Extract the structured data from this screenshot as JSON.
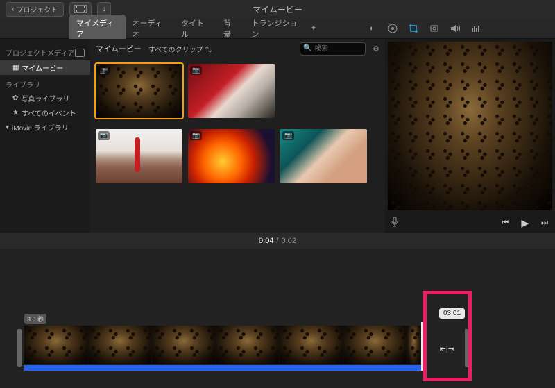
{
  "titlebar": {
    "back_label": "プロジェクト",
    "window_title": "マイムービー"
  },
  "tabs": {
    "mymedia": "マイメディア",
    "audio": "オーディオ",
    "title": "タイトル",
    "background": "背景",
    "transition": "トランジション"
  },
  "sidebar": {
    "project_media_head": "プロジェクトメディア",
    "project_item": "マイムービー",
    "library_head": "ライブラリ",
    "photo_library": "写真ライブラリ",
    "all_events": "すべてのイベント",
    "imovie_library": "iMovie ライブラリ"
  },
  "browser": {
    "title": "マイムービー",
    "filter": "すべてのクリップ",
    "search_placeholder": "検索"
  },
  "playback": {
    "current": "0:04",
    "total": "0:02"
  },
  "timeline": {
    "clip_duration": "3.0 秒",
    "trim_tooltip": "03:01"
  }
}
